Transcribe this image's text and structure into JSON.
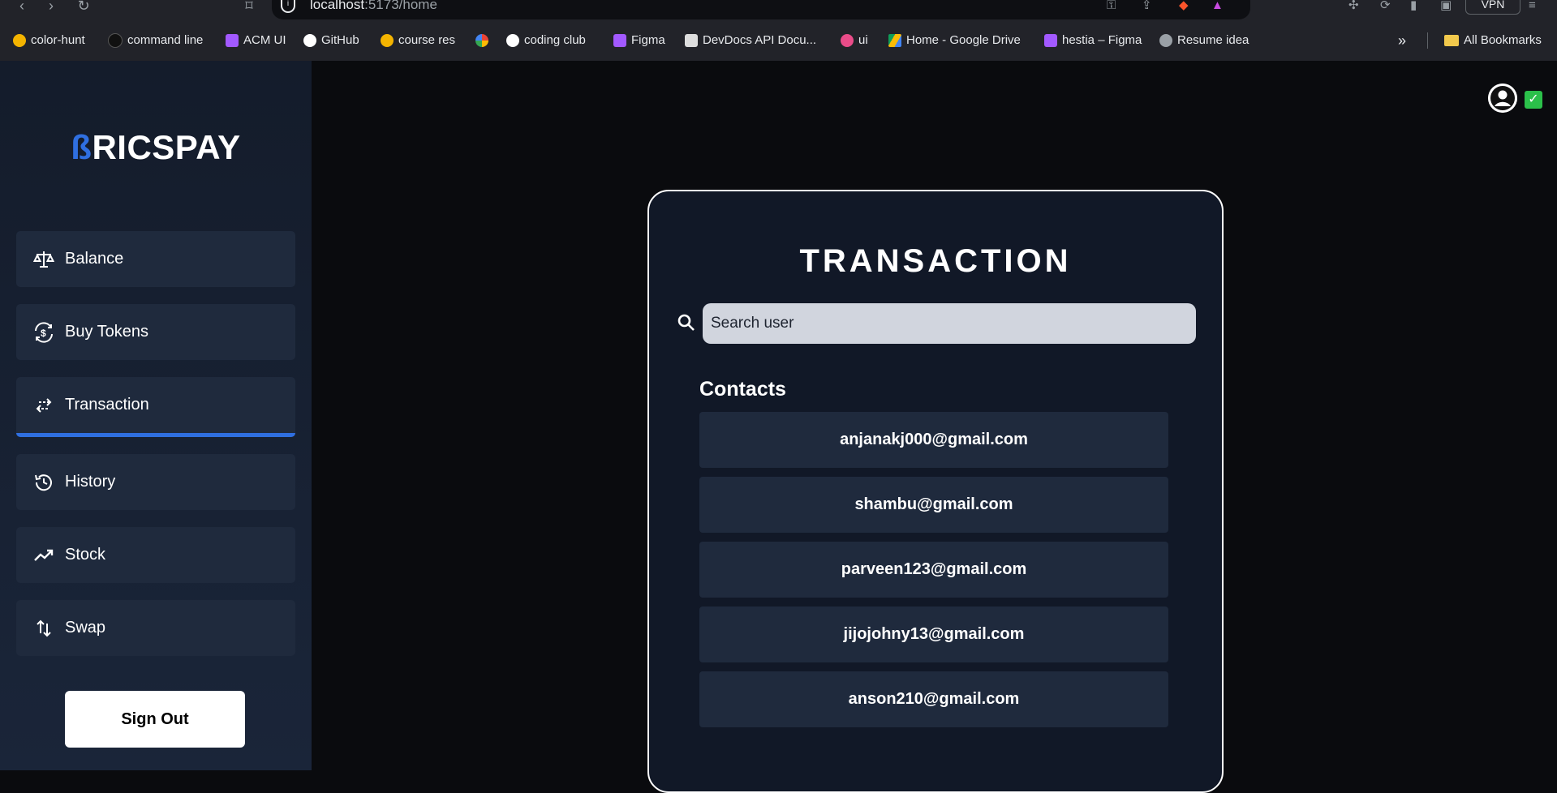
{
  "browser": {
    "url_host": "localhost",
    "url_path": ":5173/home",
    "vpn_label": "VPN",
    "bookmarks": [
      {
        "label": "color-hunt",
        "icon": "color-hunt-icon",
        "color": "#f4b400"
      },
      {
        "label": "command line",
        "icon": "command-line-icon",
        "color": "#111111"
      },
      {
        "label": "ACM UI",
        "icon": "figma-icon",
        "color": "#a259ff"
      },
      {
        "label": "GitHub",
        "icon": "github-icon",
        "color": "#ffffff"
      },
      {
        "label": "course res",
        "icon": "course-res-icon",
        "color": "#f4b400"
      },
      {
        "label": "",
        "icon": "google-photos-icon",
        "color": "#ea4335"
      },
      {
        "label": "coding club",
        "icon": "github-icon",
        "color": "#ffffff"
      },
      {
        "label": "Figma",
        "icon": "figma-icon",
        "color": "#a259ff"
      },
      {
        "label": "DevDocs API Docu...",
        "icon": "devdocs-icon",
        "color": "#dddddd"
      },
      {
        "label": "ui",
        "icon": "dribbble-icon",
        "color": "#ea4c89"
      },
      {
        "label": "Home - Google Drive",
        "icon": "google-drive-icon",
        "color": "#0f9d58"
      },
      {
        "label": "hestia – Figma",
        "icon": "figma-icon",
        "color": "#a259ff"
      },
      {
        "label": "Resume  idea",
        "icon": "globe-icon",
        "color": "#9aa0a6"
      }
    ],
    "all_bookmarks_label": "All Bookmarks"
  },
  "sidebar": {
    "logo_b": "ß",
    "logo_rest": "RICSPAY",
    "items": [
      {
        "label": "Balance",
        "icon": "scale-icon"
      },
      {
        "label": "Buy Tokens",
        "icon": "token-exchange-icon"
      },
      {
        "label": "Transaction",
        "icon": "transfer-arrows-icon",
        "active": true
      },
      {
        "label": "History",
        "icon": "history-icon"
      },
      {
        "label": "Stock",
        "icon": "trending-up-icon"
      },
      {
        "label": "Swap",
        "icon": "swap-vertical-icon"
      }
    ],
    "sign_out_label": "Sign Out"
  },
  "main": {
    "title": "TRANSACTION",
    "search_placeholder": "Search user",
    "contacts_heading": "Contacts",
    "contacts": [
      "anjanakj000@gmail.com",
      "shambu@gmail.com",
      "parveen123@gmail.com",
      "jijojohny13@gmail.com",
      "anson210@gmail.com"
    ]
  },
  "colors": {
    "accent": "#2f6fe0",
    "sidebar_bg": "#141c2b",
    "item_bg": "#1f2a3d",
    "card_bg": "#111827",
    "page_bg": "#0a0b0e",
    "verified": "#2bc04a"
  }
}
